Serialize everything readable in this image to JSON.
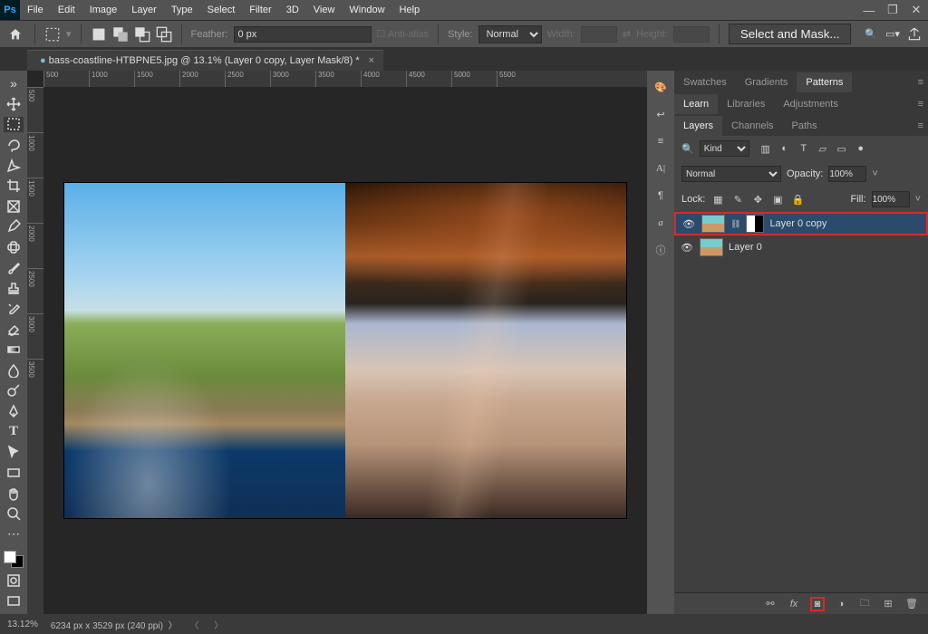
{
  "menu": [
    "File",
    "Edit",
    "Image",
    "Layer",
    "Type",
    "Select",
    "Filter",
    "3D",
    "View",
    "Window",
    "Help"
  ],
  "optbar": {
    "feather_label": "Feather:",
    "feather_value": "0 px",
    "antialias_label": "Anti-alias",
    "style_label": "Style:",
    "style_value": "Normal",
    "width_label": "Width:",
    "height_label": "Height:",
    "select_mask": "Select and Mask..."
  },
  "doc_tab": "bass-coastline-HTBPNE5.jpg @ 13.1% (Layer 0 copy, Layer Mask/8) *",
  "ruler_h": [
    "500",
    "1000",
    "1500",
    "2000",
    "2500",
    "3000",
    "3500",
    "4000",
    "4500",
    "5000",
    "5500"
  ],
  "ruler_v": [
    "500",
    "1000",
    "1500",
    "2000",
    "2500",
    "3000",
    "3500"
  ],
  "panel_tabs1": [
    "Swatches",
    "Gradients",
    "Patterns"
  ],
  "panel_tabs2": [
    "Learn",
    "Libraries",
    "Adjustments"
  ],
  "panel_tabs3": [
    "Layers",
    "Channels",
    "Paths"
  ],
  "layers_panel": {
    "kind": "Kind",
    "blend": "Normal",
    "opacity_label": "Opacity:",
    "opacity": "100%",
    "lock_label": "Lock:",
    "fill_label": "Fill:",
    "fill": "100%"
  },
  "layers": [
    {
      "name": "Layer 0 copy",
      "selected": true,
      "has_mask": true
    },
    {
      "name": "Layer 0",
      "selected": false,
      "has_mask": false
    }
  ],
  "status": {
    "zoom": "13.12%",
    "dims": "6234 px x 3529 px (240 ppi)"
  },
  "footer_icons": [
    "⟲",
    "fx",
    "◐",
    "◑",
    "▭",
    "⊞",
    "🗑"
  ]
}
